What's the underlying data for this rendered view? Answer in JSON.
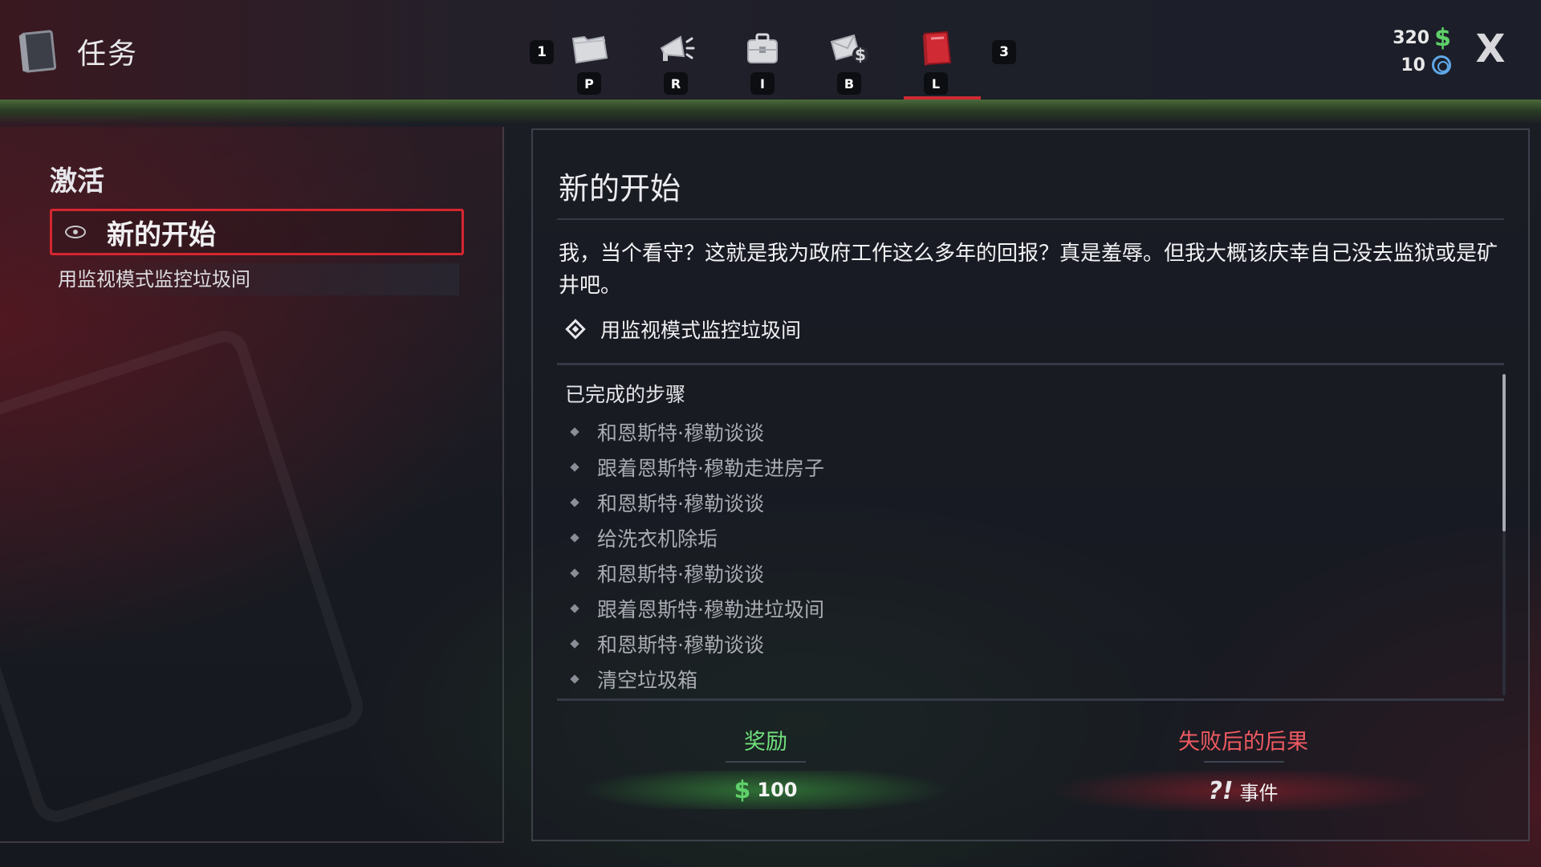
{
  "header": {
    "title": "任务",
    "prev_key": "1",
    "next_key": "3",
    "tabs": [
      {
        "key": "P",
        "icon": "folder-icon"
      },
      {
        "key": "R",
        "icon": "megaphone-icon"
      },
      {
        "key": "I",
        "icon": "toolbox-icon"
      },
      {
        "key": "B",
        "icon": "money-envelope-icon"
      },
      {
        "key": "L",
        "icon": "red-book-icon",
        "active": true
      }
    ],
    "money": "320",
    "tokens": "10",
    "close_label": "X"
  },
  "left": {
    "section": "激活",
    "quest_name": "新的开始",
    "quest_objective": "用监视模式监控垃圾间"
  },
  "detail": {
    "title": "新的开始",
    "description": "我，当个看守？这就是我为政府工作这么多年的回报？真是羞辱。但我大概该庆幸自己没去监狱或是矿井吧。",
    "objective": "用监视模式监控垃圾间",
    "completed_label": "已完成的步骤",
    "steps": [
      "和恩斯特·穆勒谈谈",
      "跟着恩斯特·穆勒走进房子",
      "和恩斯特·穆勒谈谈",
      "给洗衣机除垢",
      "和恩斯特·穆勒谈谈",
      "跟着恩斯特·穆勒进垃圾间",
      "和恩斯特·穆勒谈谈",
      "清空垃圾箱"
    ],
    "reward_label": "奖励",
    "reward_value": "100",
    "fail_label": "失败后的后果",
    "fail_icon": "?!",
    "fail_value": "事件"
  },
  "colors": {
    "accent_red": "#d5262f",
    "money_green": "#5fd16a",
    "token_blue": "#5fa8e8"
  }
}
